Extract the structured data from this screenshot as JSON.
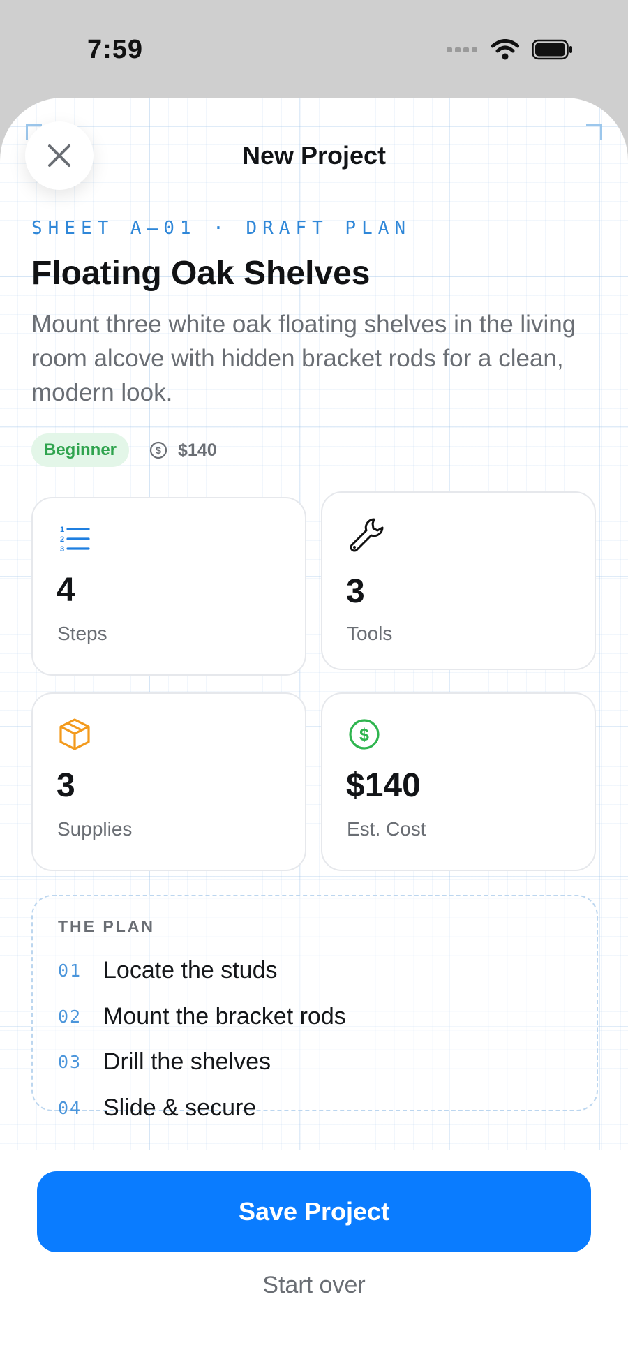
{
  "status_bar": {
    "time": "7:59"
  },
  "header": {
    "title": "New Project",
    "close_icon": "close-icon"
  },
  "project": {
    "sheet_label": "SHEET A–01 · DRAFT PLAN",
    "title": "Floating Oak Shelves",
    "description": "Mount three white oak floating shelves in the living room alcove with hidden bracket rods for a clean, modern look.",
    "difficulty": "Beginner",
    "cost": "$140"
  },
  "stats": [
    {
      "value": "4",
      "label": "Steps",
      "icon": "numbered-list-icon",
      "color": "#1f7fe0"
    },
    {
      "value": "3",
      "label": "Tools",
      "icon": "wrench-icon",
      "color": "#111111"
    },
    {
      "value": "3",
      "label": "Supplies",
      "icon": "box-icon",
      "color": "#f39a1c"
    },
    {
      "value": "$140",
      "label": "Est. Cost",
      "icon": "dollar-circle-icon",
      "color": "#2fb54f"
    }
  ],
  "plan": {
    "heading": "THE PLAN",
    "steps": [
      {
        "num": "01",
        "text": "Locate the studs"
      },
      {
        "num": "02",
        "text": "Mount the bracket rods"
      },
      {
        "num": "03",
        "text": "Drill the shelves"
      },
      {
        "num": "04",
        "text": "Slide & secure"
      }
    ]
  },
  "actions": {
    "save_label": "Save Project",
    "start_over_label": "Start over"
  },
  "colors": {
    "accent": "#0a7cff",
    "blueprint": "#2f87d8",
    "success_bg": "#e3f6e8",
    "success": "#2fa34e"
  }
}
